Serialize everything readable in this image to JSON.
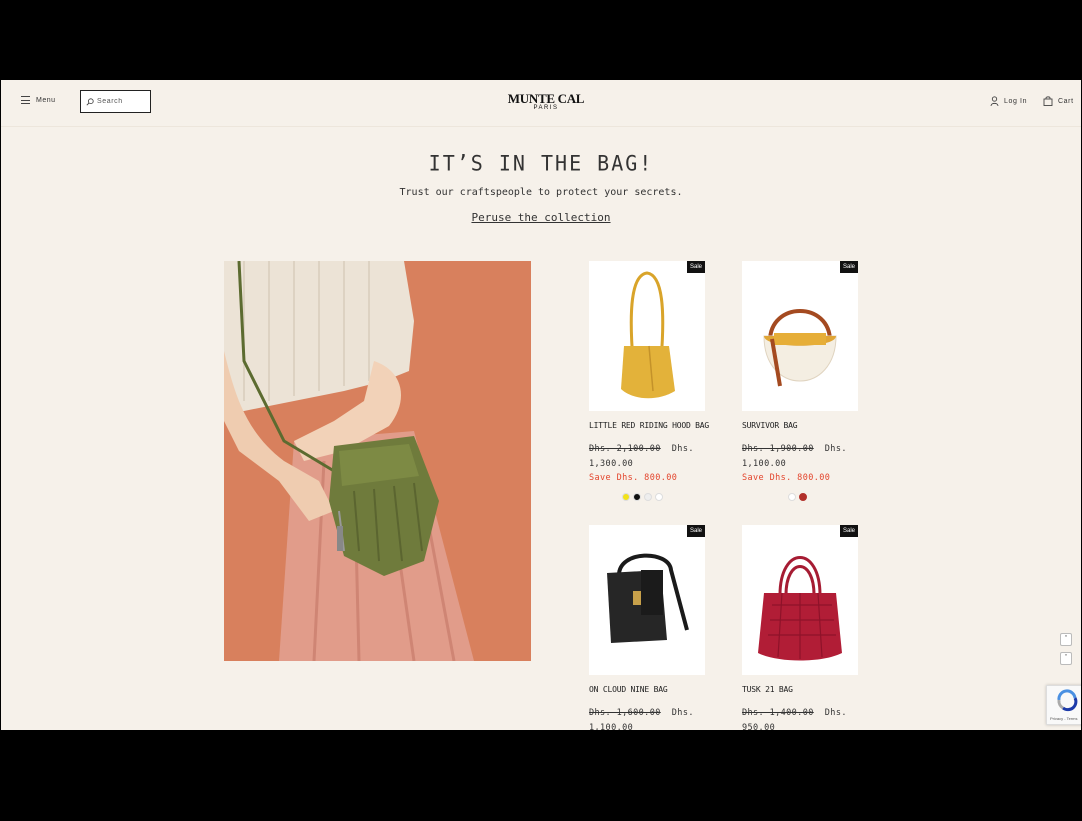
{
  "header": {
    "menu_label": "Menu",
    "search_placeholder": "Search",
    "logo_line1": "MUNTE CAL",
    "logo_line2": "PARIS",
    "login_label": "Log In",
    "cart_label": "Cart"
  },
  "hero": {
    "title": "IT’S IN THE BAG!",
    "subtitle": "Trust our craftspeople to protect your secrets.",
    "link_label": "Peruse the collection"
  },
  "products": [
    {
      "name": "LITTLE RED RIDING HOOD BAG",
      "badge": "Sale",
      "old_price": "Dhs. 2,100.00",
      "new_price": "Dhs. 1,300.00",
      "save": "Save Dhs. 800.00",
      "swatches": [
        "#f2e21a",
        "#111111",
        "#eeeeee",
        "#ffffff"
      ]
    },
    {
      "name": "SURVIVOR BAG",
      "badge": "Sale",
      "old_price": "Dhs. 1,900.00",
      "new_price": "Dhs. 1,100.00",
      "save": "Save Dhs. 800.00",
      "swatches": [
        "#ffffff",
        "#b2302a"
      ]
    },
    {
      "name": "ON CLOUD NINE BAG",
      "badge": "Sale",
      "old_price": "Dhs. 1,600.00",
      "new_price": "Dhs. 1,100.00"
    },
    {
      "name": "TUSK 21 BAG",
      "badge": "Sale",
      "old_price": "Dhs. 1,400.00",
      "new_price": "Dhs. 950.00"
    }
  ],
  "widgets": {
    "recaptcha_text": "Privacy - Terms"
  },
  "colors": {
    "background": "#f6f1ea",
    "save_text": "#e3442c",
    "sale_badge": "#111111"
  }
}
